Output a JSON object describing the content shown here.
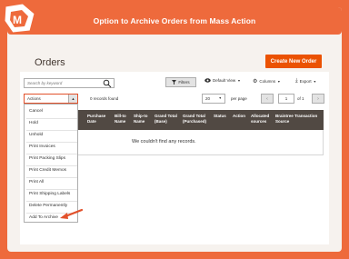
{
  "banner": {
    "title": "Option to Archive Orders from Mass Action"
  },
  "page": {
    "title": "Orders",
    "create_button": "Create New Order"
  },
  "toolbar": {
    "search_placeholder": "Search by keyword",
    "filters_label": "Filters",
    "view_label": "Default View",
    "columns_label": "Columns",
    "export_label": "Export"
  },
  "actions": {
    "label": "Actions",
    "records_found": "0 records found",
    "items": [
      "Cancel",
      "Hold",
      "Unhold",
      "Print Invoices",
      "Print Packing Slips",
      "Print Credit Memos",
      "Print All",
      "Print Shipping Labels",
      "Delete Permanently",
      "Add To Archive"
    ]
  },
  "pager": {
    "per_page_value": "20",
    "per_page_label": "per page",
    "current_page": "1",
    "of_label": "of 1"
  },
  "grid": {
    "columns": [
      "Purchase Date",
      "Bill-to Name",
      "Ship-to Name",
      "Grand Total (Base)",
      "Grand Total (Purchased)",
      "Status",
      "Action",
      "Allocated sources",
      "Braintree Transaction Source"
    ],
    "empty_message": "We couldn't find any records."
  },
  "colors": {
    "accent": "#eb5202",
    "banner": "#ee6a3c",
    "header": "#514943"
  },
  "icons": [
    "logo-icon",
    "search-icon",
    "filter-icon",
    "eye-icon",
    "gear-icon",
    "download-icon",
    "arrow-icon"
  ]
}
